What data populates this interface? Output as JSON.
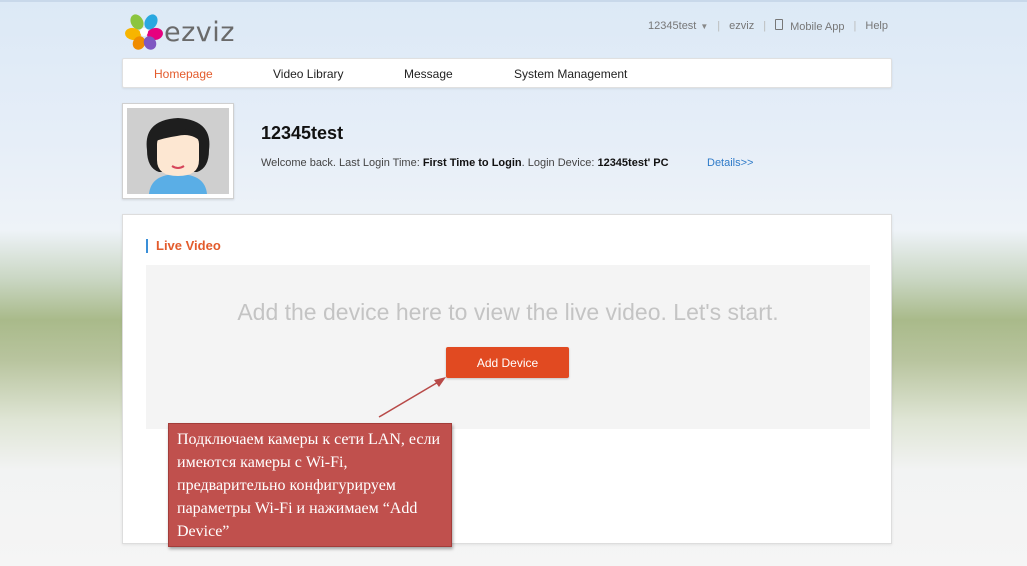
{
  "brand": {
    "name": "ezviz"
  },
  "toplinks": {
    "user": "12345test",
    "ezviz": "ezviz",
    "mobile_app": "Mobile App",
    "help": "Help"
  },
  "nav": {
    "items": [
      {
        "label": "Homepage",
        "active": true
      },
      {
        "label": "Video Library",
        "active": false
      },
      {
        "label": "Message",
        "active": false
      },
      {
        "label": "System Management",
        "active": false
      }
    ]
  },
  "profile": {
    "username": "12345test",
    "welcome_prefix": "Welcome back. Last Login Time: ",
    "last_login": "First Time to Login",
    "device_prefix": ". Login Device: ",
    "device": "12345test' PC",
    "details_link": "Details>>"
  },
  "live_video": {
    "title": "Live Video",
    "empty_text": "Add the device here to view the live video. Let's start.",
    "add_button": "Add Device"
  },
  "annotation": {
    "text": "Подключаем камеры к сети LAN, если имеются камеры с Wi-Fi, предварительно конфигурируем параметры Wi-Fi и нажимаем “Add Device”"
  },
  "colors": {
    "accent": "#e35b2c",
    "button": "#e14a21",
    "link": "#2f7bc8",
    "callout": "#c0504d"
  }
}
